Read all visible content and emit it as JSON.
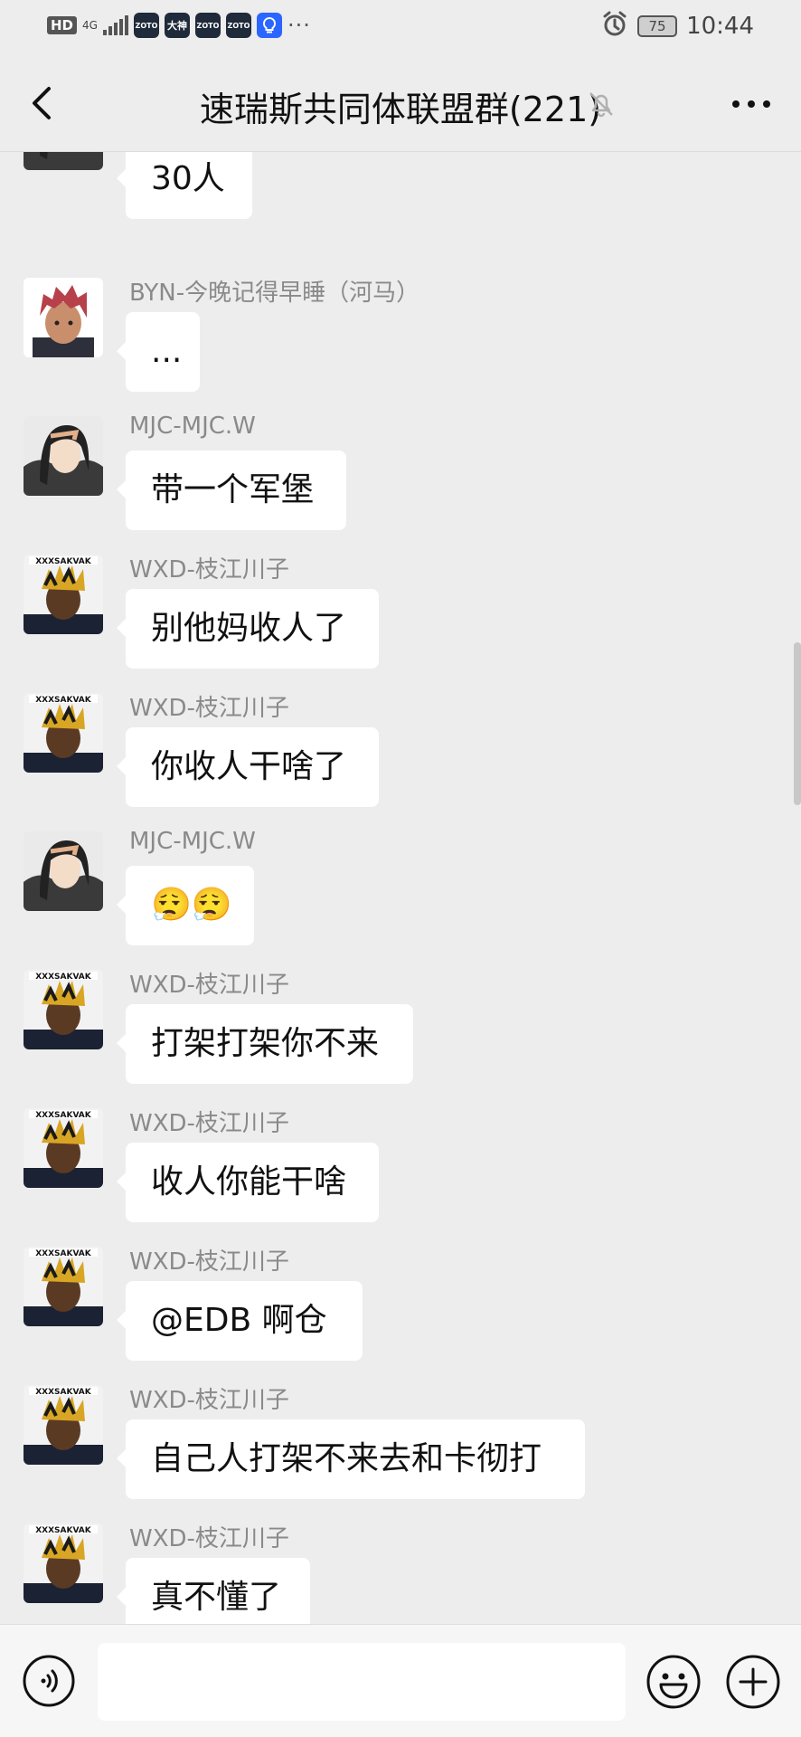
{
  "status_bar": {
    "hd": "HD",
    "network": "4G",
    "apps": [
      "ZOTO",
      "大神",
      "ZOTO",
      "ZOTO"
    ],
    "more": "···",
    "battery": "75",
    "time": "10:44"
  },
  "header": {
    "title": "速瑞斯共同体联盟群(221)"
  },
  "messages": [
    {
      "sender": "",
      "text": "30人",
      "avatar": "longhair"
    },
    {
      "sender": "BYN-今晚记得早睡（河马）",
      "text": "...",
      "avatar": "redhair"
    },
    {
      "sender": "MJC-MJC.W",
      "text": "带一个军堡",
      "avatar": "longhair"
    },
    {
      "sender": "WXD-枝江川子",
      "text": "别他妈收人了",
      "avatar": "dreads"
    },
    {
      "sender": "WXD-枝江川子",
      "text": "你收人干啥了",
      "avatar": "dreads"
    },
    {
      "sender": "MJC-MJC.W",
      "text": "😮‍💨😮‍💨",
      "avatar": "longhair"
    },
    {
      "sender": "WXD-枝江川子",
      "text": "打架打架你不来",
      "avatar": "dreads"
    },
    {
      "sender": "WXD-枝江川子",
      "text": "收人你能干啥",
      "avatar": "dreads"
    },
    {
      "sender": "WXD-枝江川子",
      "text": "@EDB 啊仓",
      "avatar": "dreads"
    },
    {
      "sender": "WXD-枝江川子",
      "text": "自己人打架不来去和卡彻打",
      "avatar": "dreads"
    },
    {
      "sender": "WXD-枝江川子",
      "text": "真不懂了",
      "avatar": "dreads"
    }
  ],
  "avatar_caption": "XXXSAKVAK",
  "input": {
    "value": "",
    "placeholder": ""
  },
  "colors": {
    "background": "#ededed",
    "bubble": "#ffffff",
    "sender_text": "#8a8a8a"
  },
  "icons": {
    "back": "chevron-left-icon",
    "mute": "bell-off-icon",
    "more": "more-horizontal-icon",
    "voice": "voice-icon",
    "emoji": "emoji-icon",
    "plus": "plus-icon"
  }
}
